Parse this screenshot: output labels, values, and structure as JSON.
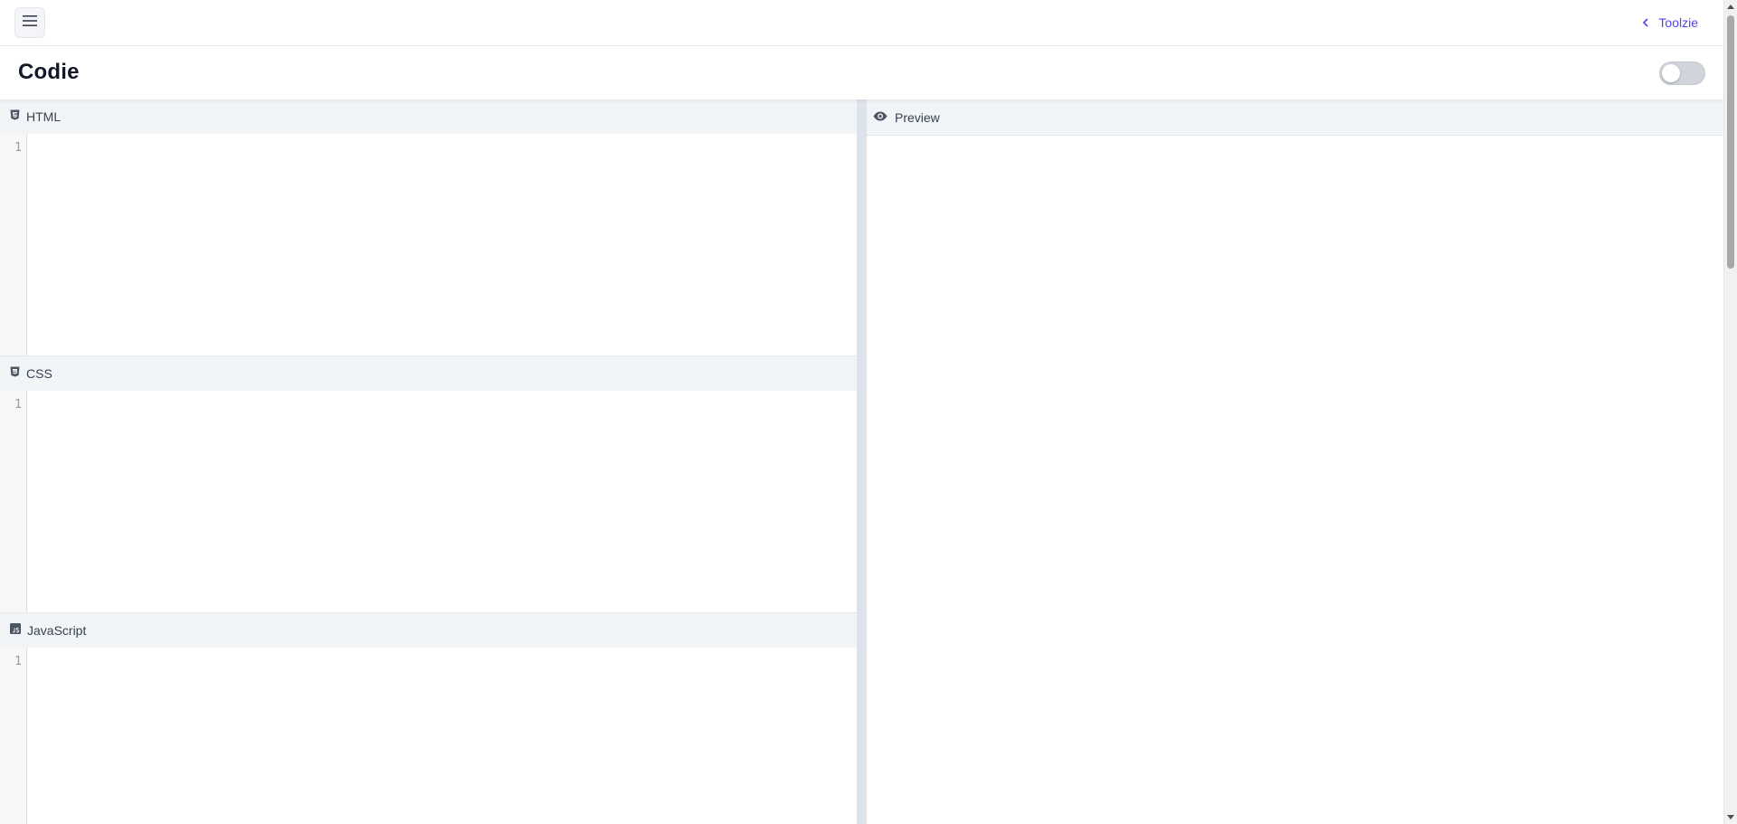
{
  "nav": {
    "menu_icon": "hamburger-icon",
    "back_icon": "chevron-left-icon",
    "back_label": "Toolzie"
  },
  "header": {
    "title": "Codie",
    "toggle_on": false
  },
  "editors": [
    {
      "label": "HTML",
      "icon": "html5-icon",
      "line_number": "1",
      "value": ""
    },
    {
      "label": "CSS",
      "icon": "css3-icon",
      "line_number": "1",
      "value": ""
    },
    {
      "label": "JavaScript",
      "icon": "js-icon",
      "line_number": "1",
      "value": ""
    }
  ],
  "preview": {
    "label": "Preview",
    "icon": "eye-icon"
  },
  "colors": {
    "accent": "#4f46e5",
    "pane_header_bg": "#f1f5f8",
    "splitter": "#dde3ea"
  }
}
